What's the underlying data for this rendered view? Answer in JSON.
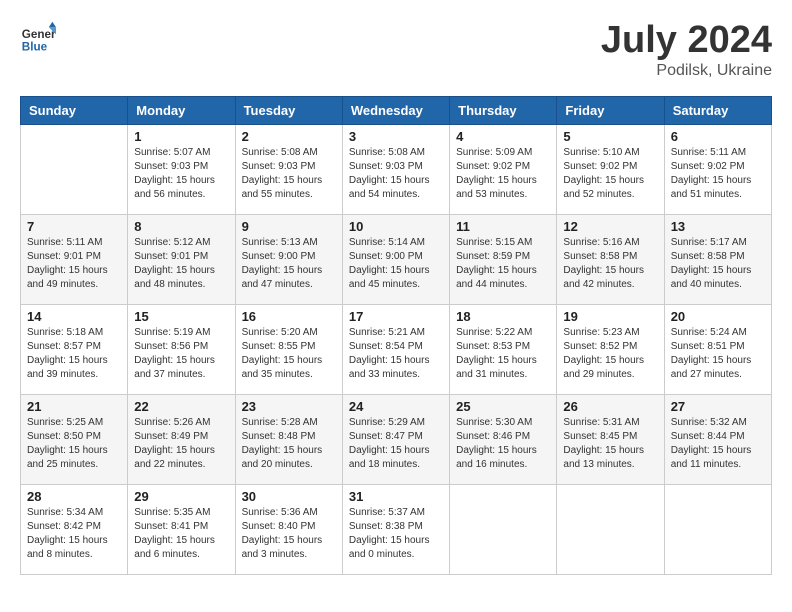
{
  "header": {
    "logo_general": "General",
    "logo_blue": "Blue",
    "month_year": "July 2024",
    "location": "Podilsk, Ukraine"
  },
  "days_of_week": [
    "Sunday",
    "Monday",
    "Tuesday",
    "Wednesday",
    "Thursday",
    "Friday",
    "Saturday"
  ],
  "weeks": [
    [
      {
        "day": "",
        "sunrise": "",
        "sunset": "",
        "daylight": ""
      },
      {
        "day": "1",
        "sunrise": "5:07 AM",
        "sunset": "9:03 PM",
        "daylight": "15 hours and 56 minutes."
      },
      {
        "day": "2",
        "sunrise": "5:08 AM",
        "sunset": "9:03 PM",
        "daylight": "15 hours and 55 minutes."
      },
      {
        "day": "3",
        "sunrise": "5:08 AM",
        "sunset": "9:03 PM",
        "daylight": "15 hours and 54 minutes."
      },
      {
        "day": "4",
        "sunrise": "5:09 AM",
        "sunset": "9:02 PM",
        "daylight": "15 hours and 53 minutes."
      },
      {
        "day": "5",
        "sunrise": "5:10 AM",
        "sunset": "9:02 PM",
        "daylight": "15 hours and 52 minutes."
      },
      {
        "day": "6",
        "sunrise": "5:11 AM",
        "sunset": "9:02 PM",
        "daylight": "15 hours and 51 minutes."
      }
    ],
    [
      {
        "day": "7",
        "sunrise": "5:11 AM",
        "sunset": "9:01 PM",
        "daylight": "15 hours and 49 minutes."
      },
      {
        "day": "8",
        "sunrise": "5:12 AM",
        "sunset": "9:01 PM",
        "daylight": "15 hours and 48 minutes."
      },
      {
        "day": "9",
        "sunrise": "5:13 AM",
        "sunset": "9:00 PM",
        "daylight": "15 hours and 47 minutes."
      },
      {
        "day": "10",
        "sunrise": "5:14 AM",
        "sunset": "9:00 PM",
        "daylight": "15 hours and 45 minutes."
      },
      {
        "day": "11",
        "sunrise": "5:15 AM",
        "sunset": "8:59 PM",
        "daylight": "15 hours and 44 minutes."
      },
      {
        "day": "12",
        "sunrise": "5:16 AM",
        "sunset": "8:58 PM",
        "daylight": "15 hours and 42 minutes."
      },
      {
        "day": "13",
        "sunrise": "5:17 AM",
        "sunset": "8:58 PM",
        "daylight": "15 hours and 40 minutes."
      }
    ],
    [
      {
        "day": "14",
        "sunrise": "5:18 AM",
        "sunset": "8:57 PM",
        "daylight": "15 hours and 39 minutes."
      },
      {
        "day": "15",
        "sunrise": "5:19 AM",
        "sunset": "8:56 PM",
        "daylight": "15 hours and 37 minutes."
      },
      {
        "day": "16",
        "sunrise": "5:20 AM",
        "sunset": "8:55 PM",
        "daylight": "15 hours and 35 minutes."
      },
      {
        "day": "17",
        "sunrise": "5:21 AM",
        "sunset": "8:54 PM",
        "daylight": "15 hours and 33 minutes."
      },
      {
        "day": "18",
        "sunrise": "5:22 AM",
        "sunset": "8:53 PM",
        "daylight": "15 hours and 31 minutes."
      },
      {
        "day": "19",
        "sunrise": "5:23 AM",
        "sunset": "8:52 PM",
        "daylight": "15 hours and 29 minutes."
      },
      {
        "day": "20",
        "sunrise": "5:24 AM",
        "sunset": "8:51 PM",
        "daylight": "15 hours and 27 minutes."
      }
    ],
    [
      {
        "day": "21",
        "sunrise": "5:25 AM",
        "sunset": "8:50 PM",
        "daylight": "15 hours and 25 minutes."
      },
      {
        "day": "22",
        "sunrise": "5:26 AM",
        "sunset": "8:49 PM",
        "daylight": "15 hours and 22 minutes."
      },
      {
        "day": "23",
        "sunrise": "5:28 AM",
        "sunset": "8:48 PM",
        "daylight": "15 hours and 20 minutes."
      },
      {
        "day": "24",
        "sunrise": "5:29 AM",
        "sunset": "8:47 PM",
        "daylight": "15 hours and 18 minutes."
      },
      {
        "day": "25",
        "sunrise": "5:30 AM",
        "sunset": "8:46 PM",
        "daylight": "15 hours and 16 minutes."
      },
      {
        "day": "26",
        "sunrise": "5:31 AM",
        "sunset": "8:45 PM",
        "daylight": "15 hours and 13 minutes."
      },
      {
        "day": "27",
        "sunrise": "5:32 AM",
        "sunset": "8:44 PM",
        "daylight": "15 hours and 11 minutes."
      }
    ],
    [
      {
        "day": "28",
        "sunrise": "5:34 AM",
        "sunset": "8:42 PM",
        "daylight": "15 hours and 8 minutes."
      },
      {
        "day": "29",
        "sunrise": "5:35 AM",
        "sunset": "8:41 PM",
        "daylight": "15 hours and 6 minutes."
      },
      {
        "day": "30",
        "sunrise": "5:36 AM",
        "sunset": "8:40 PM",
        "daylight": "15 hours and 3 minutes."
      },
      {
        "day": "31",
        "sunrise": "5:37 AM",
        "sunset": "8:38 PM",
        "daylight": "15 hours and 0 minutes."
      },
      {
        "day": "",
        "sunrise": "",
        "sunset": "",
        "daylight": ""
      },
      {
        "day": "",
        "sunrise": "",
        "sunset": "",
        "daylight": ""
      },
      {
        "day": "",
        "sunrise": "",
        "sunset": "",
        "daylight": ""
      }
    ]
  ]
}
